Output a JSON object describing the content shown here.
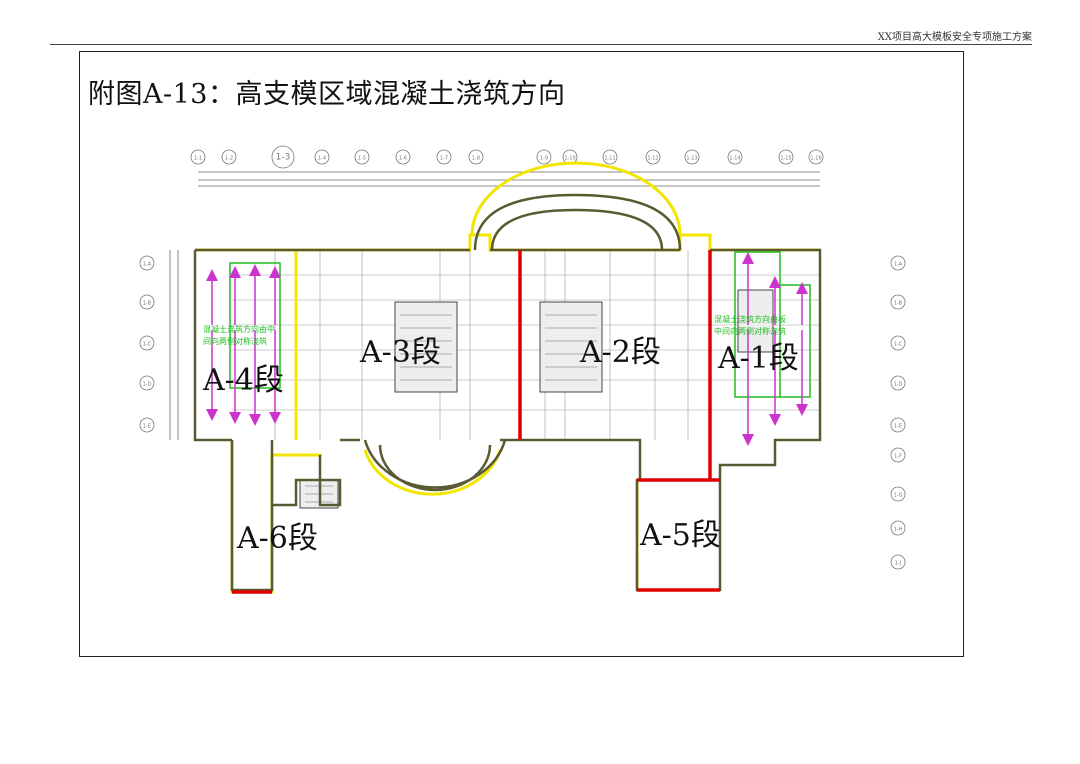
{
  "header": {
    "text": "XX项目高大模板安全专项施工方案"
  },
  "figure": {
    "title": "附图A-13：高支模区域混凝土浇筑方向"
  },
  "sections": [
    {
      "id": "A-1",
      "label": "A-1段"
    },
    {
      "id": "A-2",
      "label": "A-2段"
    },
    {
      "id": "A-3",
      "label": "A-3段"
    },
    {
      "id": "A-4",
      "label": "A-4段"
    },
    {
      "id": "A-5",
      "label": "A-5段"
    },
    {
      "id": "A-6",
      "label": "A-6段"
    }
  ],
  "notes": {
    "left": [
      "混凝土浇筑方向由中",
      "间向两侧对称浇筑"
    ],
    "right": [
      "混凝土浇筑方向由板",
      "中间向两侧对称浇筑"
    ]
  },
  "axis_top": [
    "1-1",
    "1-2",
    "1-3",
    "1-4",
    "1-5",
    "1-6",
    "1-7",
    "1-8",
    "1-9",
    "1-10",
    "1-11",
    "1-12",
    "1-13",
    "1-14",
    "1-15",
    "1-16"
  ],
  "axis_side": [
    "1-A",
    "1-B",
    "1-C",
    "1-D",
    "1-E",
    "1-F",
    "1-G",
    "1-H",
    "1-J",
    "1-K"
  ],
  "colors": {
    "outline": "#5a5a32",
    "highlight": "#f2e600",
    "divider": "#e00000",
    "note_green": "#22bb22",
    "arrow": "#cc33cc"
  }
}
